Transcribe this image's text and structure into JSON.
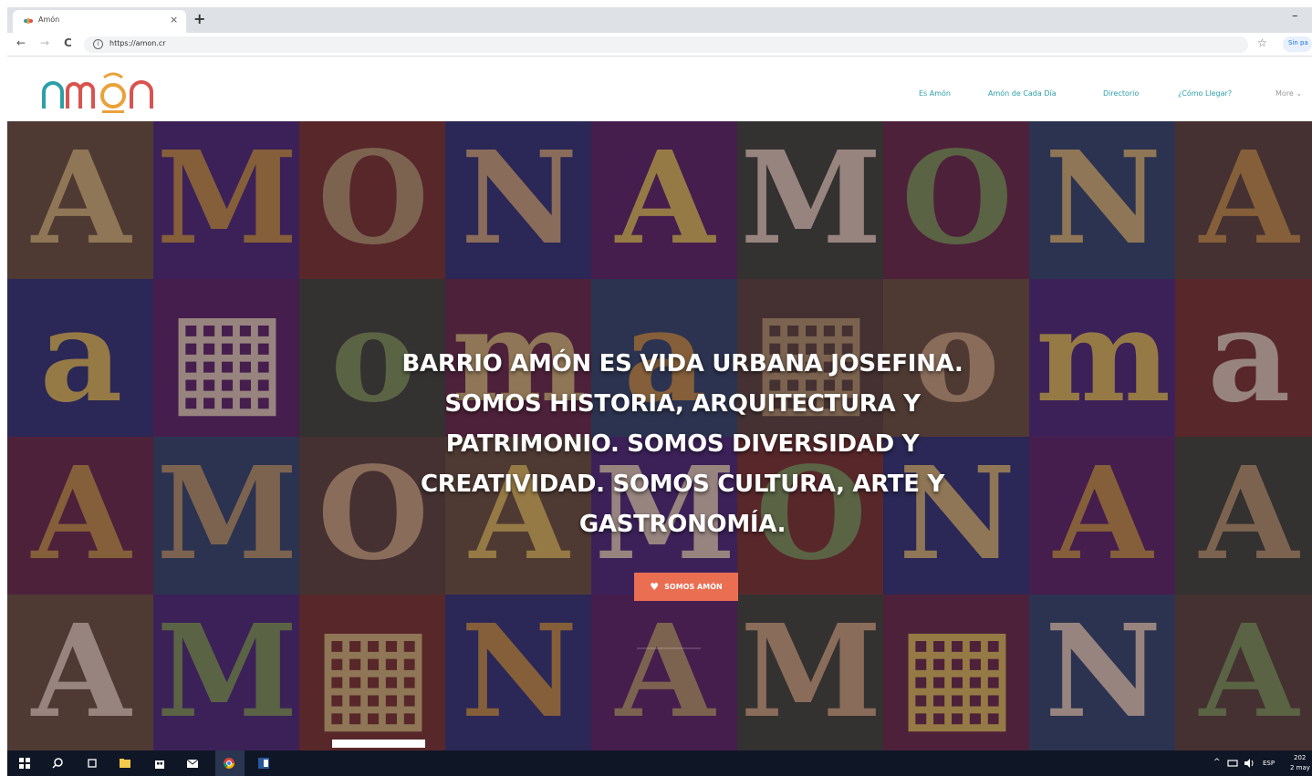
{
  "browser": {
    "tab_title": "Amón",
    "tab_close": "×",
    "new_tab": "+",
    "minimize": "–",
    "back": "←",
    "forward": "→",
    "reload": "C",
    "info": "i",
    "url": "https://amon.cr",
    "bookmark": "☆",
    "signin_label": "Sin pa"
  },
  "site": {
    "logo_text": "amón",
    "nav": [
      {
        "label": "Es Amón"
      },
      {
        "label": "Amón de Cada Día"
      },
      {
        "label": "Directorio"
      },
      {
        "label": "¿Cómo Llegar?"
      },
      {
        "label": "More ⌄"
      }
    ]
  },
  "hero": {
    "headline": "BARRIO AMÓN ES VIDA URBANA JOSEFINA. SOMOS HISTORIA, ARQUITECTURA Y PATRIMONIO. SOMOS DIVERSIDAD Y CREATIVIDAD. SOMOS CULTURA, ARTE Y GASTRONOMÍA.",
    "cta_label": "SOMOS AMÓN",
    "cta_color": "#ea6e52"
  },
  "taskbar": {
    "lang": "ESP",
    "time": "202",
    "date": "2 may"
  }
}
